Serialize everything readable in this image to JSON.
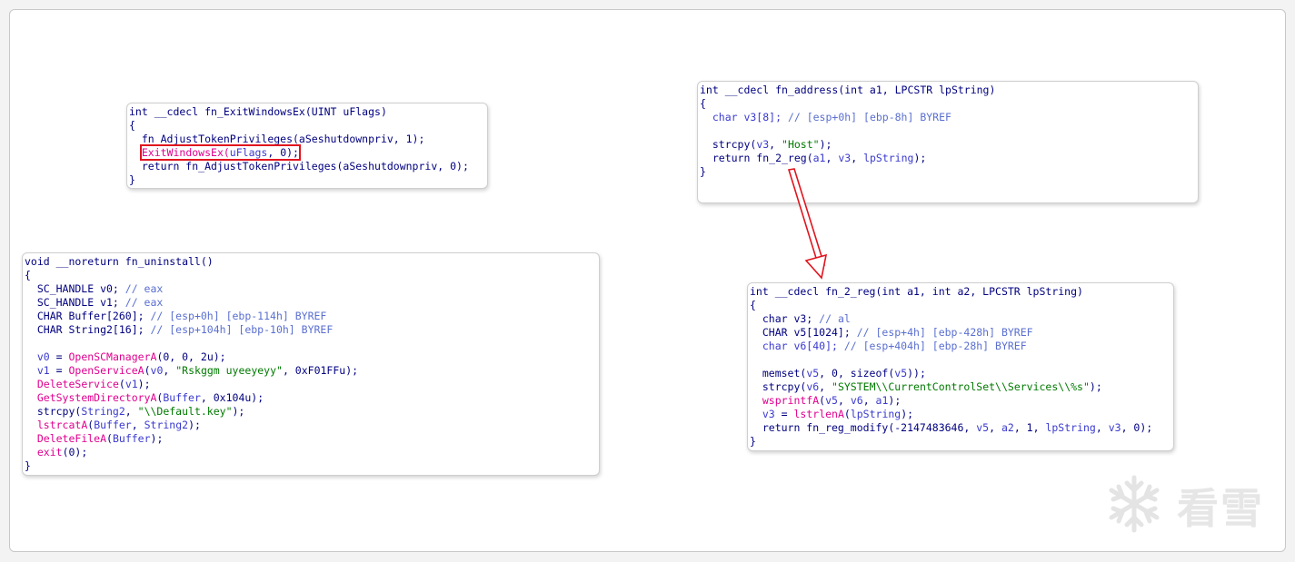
{
  "boxes": {
    "exitwindows": {
      "lines": [
        [
          {
            "t": "int __cdecl fn_ExitWindowsEx(UINT uFlags)",
            "c": "t"
          }
        ],
        [
          {
            "t": "{",
            "c": "k"
          }
        ],
        [
          {
            "t": "  fn_AdjustTokenPrivileges(aSeshutdownpriv, 1);",
            "c": "k"
          }
        ],
        [
          {
            "t": "  ",
            "c": "k"
          },
          {
            "t": "ExitWindowsEx(",
            "c": "imp",
            "hl": true
          },
          {
            "t": "uFlags",
            "c": "v",
            "hl": true
          },
          {
            "t": ", 0);",
            "c": "k",
            "hl": true
          }
        ],
        [
          {
            "t": "  return fn_AdjustTokenPrivileges(aSeshutdownpriv, 0);",
            "c": "k"
          }
        ],
        [
          {
            "t": "}",
            "c": "k"
          }
        ]
      ]
    },
    "address": {
      "lines": [
        [
          {
            "t": "int __cdecl fn_address(int a1, LPCSTR lpString)",
            "c": "t"
          }
        ],
        [
          {
            "t": "{",
            "c": "k"
          }
        ],
        [
          {
            "t": "  char v3[8]; ",
            "c": "v"
          },
          {
            "t": "// [esp+0h] [ebp-8h] BYREF",
            "c": "c"
          }
        ],
        [
          {
            "t": "",
            "c": "k"
          }
        ],
        [
          {
            "t": "  strcpy(",
            "c": "k"
          },
          {
            "t": "v3",
            "c": "v"
          },
          {
            "t": ", ",
            "c": "k"
          },
          {
            "t": "\"Host\"",
            "c": "s"
          },
          {
            "t": ");",
            "c": "k"
          }
        ],
        [
          {
            "t": "  return fn_2_reg(",
            "c": "k"
          },
          {
            "t": "a1",
            "c": "v"
          },
          {
            "t": ", ",
            "c": "k"
          },
          {
            "t": "v3",
            "c": "v"
          },
          {
            "t": ", ",
            "c": "k"
          },
          {
            "t": "lpString",
            "c": "v"
          },
          {
            "t": ");",
            "c": "k"
          }
        ],
        [
          {
            "t": "}",
            "c": "k"
          }
        ]
      ]
    },
    "uninstall": {
      "lines": [
        [
          {
            "t": "void __noreturn fn_uninstall()",
            "c": "t"
          }
        ],
        [
          {
            "t": "{",
            "c": "k"
          }
        ],
        [
          {
            "t": "  SC_HANDLE v0; ",
            "c": "k"
          },
          {
            "t": "// eax",
            "c": "c"
          }
        ],
        [
          {
            "t": "  SC_HANDLE v1; ",
            "c": "k"
          },
          {
            "t": "// eax",
            "c": "c"
          }
        ],
        [
          {
            "t": "  CHAR Buffer[260]; ",
            "c": "k"
          },
          {
            "t": "// [esp+0h] [ebp-114h] BYREF",
            "c": "c"
          }
        ],
        [
          {
            "t": "  CHAR String2[16]; ",
            "c": "k"
          },
          {
            "t": "// [esp+104h] [ebp-10h] BYREF",
            "c": "c"
          }
        ],
        [
          {
            "t": "",
            "c": "k"
          }
        ],
        [
          {
            "t": "  ",
            "c": "k"
          },
          {
            "t": "v0",
            "c": "v"
          },
          {
            "t": " = ",
            "c": "k"
          },
          {
            "t": "OpenSCManagerA",
            "c": "imp"
          },
          {
            "t": "(0, 0, 2u);",
            "c": "k"
          }
        ],
        [
          {
            "t": "  ",
            "c": "k"
          },
          {
            "t": "v1",
            "c": "v"
          },
          {
            "t": " = ",
            "c": "k"
          },
          {
            "t": "OpenServiceA",
            "c": "imp"
          },
          {
            "t": "(",
            "c": "k"
          },
          {
            "t": "v0",
            "c": "v"
          },
          {
            "t": ", ",
            "c": "k"
          },
          {
            "t": "\"Rskggm uyeeyeyy\"",
            "c": "s"
          },
          {
            "t": ", 0xF01FFu);",
            "c": "k"
          }
        ],
        [
          {
            "t": "  ",
            "c": "k"
          },
          {
            "t": "DeleteService",
            "c": "imp"
          },
          {
            "t": "(",
            "c": "k"
          },
          {
            "t": "v1",
            "c": "v"
          },
          {
            "t": ");",
            "c": "k"
          }
        ],
        [
          {
            "t": "  ",
            "c": "k"
          },
          {
            "t": "GetSystemDirectoryA",
            "c": "imp"
          },
          {
            "t": "(",
            "c": "k"
          },
          {
            "t": "Buffer",
            "c": "v"
          },
          {
            "t": ", 0x104u);",
            "c": "k"
          }
        ],
        [
          {
            "t": "  strcpy(",
            "c": "k"
          },
          {
            "t": "String2",
            "c": "v"
          },
          {
            "t": ", ",
            "c": "k"
          },
          {
            "t": "\"\\\\Default.key\"",
            "c": "s"
          },
          {
            "t": ");",
            "c": "k"
          }
        ],
        [
          {
            "t": "  ",
            "c": "k"
          },
          {
            "t": "lstrcatA",
            "c": "imp"
          },
          {
            "t": "(",
            "c": "k"
          },
          {
            "t": "Buffer",
            "c": "v"
          },
          {
            "t": ", ",
            "c": "k"
          },
          {
            "t": "String2",
            "c": "v"
          },
          {
            "t": ");",
            "c": "k"
          }
        ],
        [
          {
            "t": "  ",
            "c": "k"
          },
          {
            "t": "DeleteFileA",
            "c": "imp"
          },
          {
            "t": "(",
            "c": "k"
          },
          {
            "t": "Buffer",
            "c": "v"
          },
          {
            "t": ");",
            "c": "k"
          }
        ],
        [
          {
            "t": "  ",
            "c": "k"
          },
          {
            "t": "exit",
            "c": "imp"
          },
          {
            "t": "(0);",
            "c": "k"
          }
        ],
        [
          {
            "t": "}",
            "c": "k"
          }
        ]
      ]
    },
    "reg": {
      "lines": [
        [
          {
            "t": "int __cdecl fn_2_reg(int a1, int a2, LPCSTR lpString)",
            "c": "t"
          }
        ],
        [
          {
            "t": "{",
            "c": "k"
          }
        ],
        [
          {
            "t": "  char v3; ",
            "c": "k"
          },
          {
            "t": "// al",
            "c": "c"
          }
        ],
        [
          {
            "t": "  CHAR v5[1024]; ",
            "c": "k"
          },
          {
            "t": "// [esp+4h] [ebp-428h] BYREF",
            "c": "c"
          }
        ],
        [
          {
            "t": "  char v6[40]; ",
            "c": "v"
          },
          {
            "t": "// [esp+404h] [ebp-28h] BYREF",
            "c": "c"
          }
        ],
        [
          {
            "t": "",
            "c": "k"
          }
        ],
        [
          {
            "t": "  memset(",
            "c": "k"
          },
          {
            "t": "v5",
            "c": "v"
          },
          {
            "t": ", 0, sizeof(",
            "c": "k"
          },
          {
            "t": "v5",
            "c": "v"
          },
          {
            "t": "));",
            "c": "k"
          }
        ],
        [
          {
            "t": "  strcpy(",
            "c": "k"
          },
          {
            "t": "v6",
            "c": "v"
          },
          {
            "t": ", ",
            "c": "k"
          },
          {
            "t": "\"SYSTEM\\\\CurrentControlSet\\\\Services\\\\%s\"",
            "c": "s"
          },
          {
            "t": ");",
            "c": "k"
          }
        ],
        [
          {
            "t": "  ",
            "c": "k"
          },
          {
            "t": "wsprintfA",
            "c": "imp"
          },
          {
            "t": "(",
            "c": "k"
          },
          {
            "t": "v5",
            "c": "v"
          },
          {
            "t": ", ",
            "c": "k"
          },
          {
            "t": "v6",
            "c": "v"
          },
          {
            "t": ", ",
            "c": "k"
          },
          {
            "t": "a1",
            "c": "v"
          },
          {
            "t": ");",
            "c": "k"
          }
        ],
        [
          {
            "t": "  ",
            "c": "k"
          },
          {
            "t": "v3",
            "c": "v"
          },
          {
            "t": " = ",
            "c": "k"
          },
          {
            "t": "lstrlenA",
            "c": "imp"
          },
          {
            "t": "(",
            "c": "k"
          },
          {
            "t": "lpString",
            "c": "v"
          },
          {
            "t": ");",
            "c": "k"
          }
        ],
        [
          {
            "t": "  return fn_reg_modify(-2147483646, ",
            "c": "k"
          },
          {
            "t": "v5",
            "c": "v"
          },
          {
            "t": ", ",
            "c": "k"
          },
          {
            "t": "a2",
            "c": "v"
          },
          {
            "t": ", 1, ",
            "c": "k"
          },
          {
            "t": "lpString",
            "c": "v"
          },
          {
            "t": ", ",
            "c": "k"
          },
          {
            "t": "v3",
            "c": "v"
          },
          {
            "t": ", 0);",
            "c": "k"
          }
        ],
        [
          {
            "t": "}",
            "c": "k"
          }
        ]
      ]
    }
  },
  "watermark": {
    "text": "看雪",
    "icon": "snowflake-icon"
  },
  "colors": {
    "keyword": "#000080",
    "import": "#e0008f",
    "variable": "#3a3acf",
    "string": "#007a00",
    "comment": "#5a6fd0",
    "highlight": "#e0141e",
    "arrow": "#e0141e"
  }
}
